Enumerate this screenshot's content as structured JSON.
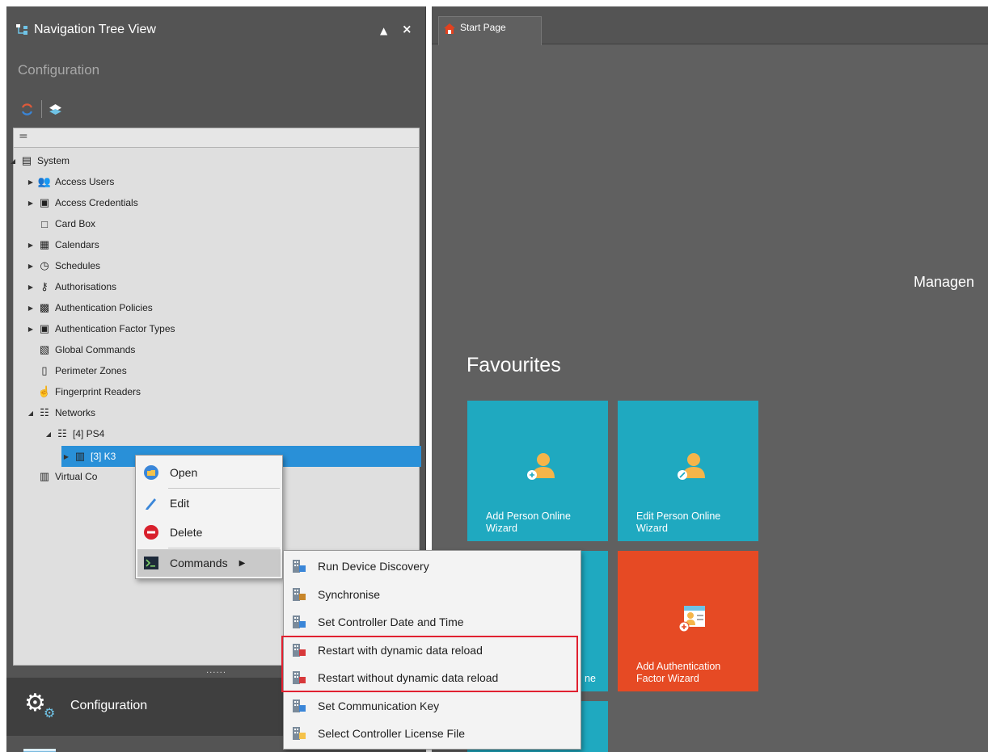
{
  "panel": {
    "title": "Navigation Tree View",
    "pin_glyph": "⬢",
    "close_glyph": "×",
    "section": "Configuration",
    "search_glyph": "="
  },
  "tree": [
    {
      "label": "System",
      "icon": "system-icon",
      "arrow": "◢"
    },
    {
      "label": "Access Users",
      "icon": "users-icon",
      "arrow": "▶"
    },
    {
      "label": "Access Credentials",
      "icon": "credentials-icon",
      "arrow": "▶"
    },
    {
      "label": "Card Box",
      "icon": "card-box-icon",
      "arrow": ""
    },
    {
      "label": "Calendars",
      "icon": "calendar-icon",
      "arrow": "▶"
    },
    {
      "label": "Schedules",
      "icon": "schedule-icon",
      "arrow": "▶"
    },
    {
      "label": "Authorisations",
      "icon": "key-icon",
      "arrow": "▶"
    },
    {
      "label": "Authentication Policies",
      "icon": "policy-icon",
      "arrow": "▶"
    },
    {
      "label": "Authentication Factor Types",
      "icon": "factor-icon",
      "arrow": "▶"
    },
    {
      "label": "Global Commands",
      "icon": "global-commands-icon",
      "arrow": ""
    },
    {
      "label": "Perimeter Zones",
      "icon": "zone-icon",
      "arrow": ""
    },
    {
      "label": "Fingerprint Readers",
      "icon": "fingerprint-icon",
      "arrow": ""
    },
    {
      "label": "Networks",
      "icon": "network-icon",
      "arrow": "◢"
    },
    {
      "label": "[4] PS4",
      "icon": "network-icon",
      "arrow": "◢"
    },
    {
      "label": "[3] K3",
      "icon": "controller-icon",
      "arrow": "▶"
    },
    {
      "label": "Virtual Co",
      "icon": "virtual-controller-icon",
      "arrow": ""
    }
  ],
  "config_bar": {
    "label": "Configuration",
    "splitter": "......"
  },
  "tabs": {
    "start_page": "Start Page"
  },
  "main": {
    "manage_text": "Managen",
    "favourites_title": "Favourites",
    "tiles": [
      {
        "label": "Add Person Online Wizard",
        "color": "#1fa9c0"
      },
      {
        "label": "Edit Person Online Wizard",
        "color": "#1fa9c0"
      },
      {
        "label": "ne",
        "color": "#1fa9c0"
      },
      {
        "label": "Add Authentication Factor Wizard",
        "color": "#e64a24"
      }
    ]
  },
  "context_menu": {
    "items": [
      {
        "label": "Open",
        "icon": "open-folder-icon"
      },
      {
        "label": "Edit",
        "icon": "pencil-icon"
      },
      {
        "label": "Delete",
        "icon": "delete-icon"
      },
      {
        "label": "Commands",
        "icon": "terminal-icon",
        "submenu_arrow": "▶"
      }
    ]
  },
  "submenu": {
    "items": [
      {
        "label": "Run Device Discovery",
        "icon": "discovery-icon"
      },
      {
        "label": "Synchronise",
        "icon": "synchronise-icon"
      },
      {
        "label": "Set Controller Date and Time",
        "icon": "date-time-icon"
      },
      {
        "label": "Restart with dynamic data reload",
        "icon": "restart-reload-icon"
      },
      {
        "label": "Restart without dynamic data reload",
        "icon": "restart-no-reload-icon"
      },
      {
        "label": "Set Communication Key",
        "icon": "communication-key-icon"
      },
      {
        "label": "Select Controller License File",
        "icon": "license-file-icon"
      }
    ]
  },
  "colors": {
    "accent_blue": "#2990d8",
    "tile_teal": "#1fa9c0",
    "tile_orange": "#e64a24",
    "highlight_red": "#e02030"
  }
}
